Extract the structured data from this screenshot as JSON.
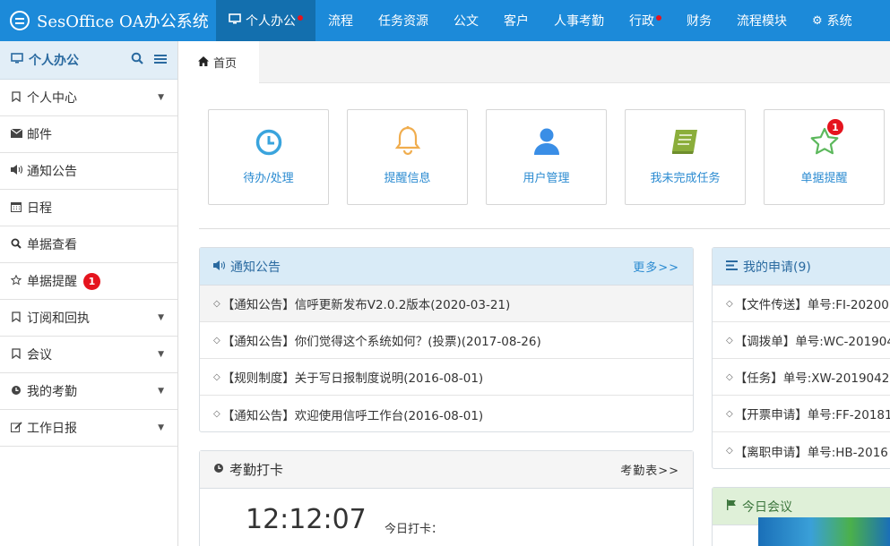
{
  "app": {
    "title": "SesOffice OA办公系统"
  },
  "nav": [
    {
      "label": "个人办公",
      "icon": "monitor-icon",
      "active": true,
      "dot": true
    },
    {
      "label": "流程"
    },
    {
      "label": "任务资源"
    },
    {
      "label": "公文"
    },
    {
      "label": "客户"
    },
    {
      "label": "人事考勤"
    },
    {
      "label": "行政",
      "dot": true
    },
    {
      "label": "财务"
    },
    {
      "label": "流程模块"
    },
    {
      "label": "系统",
      "icon": "gear-icon"
    }
  ],
  "sidebar": {
    "title": "个人办公",
    "items": [
      {
        "label": "个人中心",
        "icon": "bookmark-icon",
        "caret": true
      },
      {
        "label": "邮件",
        "icon": "envelope-icon"
      },
      {
        "label": "通知公告",
        "icon": "volume-icon"
      },
      {
        "label": "日程",
        "icon": "calendar-icon"
      },
      {
        "label": "单据查看",
        "icon": "search-icon"
      },
      {
        "label": "单据提醒",
        "icon": "star-icon",
        "badge": "1"
      },
      {
        "label": "订阅和回执",
        "icon": "bookmark-icon",
        "caret": true
      },
      {
        "label": "会议",
        "icon": "bookmark-icon",
        "caret": true
      },
      {
        "label": "我的考勤",
        "icon": "clock-icon",
        "caret": true
      },
      {
        "label": "工作日报",
        "icon": "edit-icon",
        "caret": true
      }
    ]
  },
  "tabs": {
    "home": "首页"
  },
  "tiles": [
    {
      "label": "待办/处理",
      "icon": "clock-icon",
      "color": "#3aa4dd"
    },
    {
      "label": "提醒信息",
      "icon": "bell-icon",
      "color": "#f0ad4e"
    },
    {
      "label": "用户管理",
      "icon": "user-icon",
      "color": "#3a8ee6"
    },
    {
      "label": "我未完成任务",
      "icon": "book-icon",
      "color": "#8bae3b"
    },
    {
      "label": "单据提醒",
      "icon": "star-icon",
      "color": "#5cb85c",
      "badge": "1"
    }
  ],
  "notices": {
    "title": "通知公告",
    "more": "更多>>",
    "items": [
      "【通知公告】信呼更新发布V2.0.2版本(2020-03-21)",
      "【通知公告】你们觉得这个系统如何？(投票)(2017-08-26)",
      "【规则制度】关于写日报制度说明(2016-08-01)",
      "【通知公告】欢迎使用信呼工作台(2016-08-01)"
    ]
  },
  "applications": {
    "title": "我的申请(9)",
    "items": [
      "【文件传送】单号:FI-20200",
      "【调拨单】单号:WC-201904",
      "【任务】单号:XW-2019042",
      "【开票申请】单号:FF-20181",
      "【离职申请】单号:HB-2016"
    ]
  },
  "attendance": {
    "title": "考勤打卡",
    "link": "考勤表>>",
    "time": "12:12:07",
    "punch_label": "今日打卡："
  },
  "meeting": {
    "title": "今日会议"
  }
}
